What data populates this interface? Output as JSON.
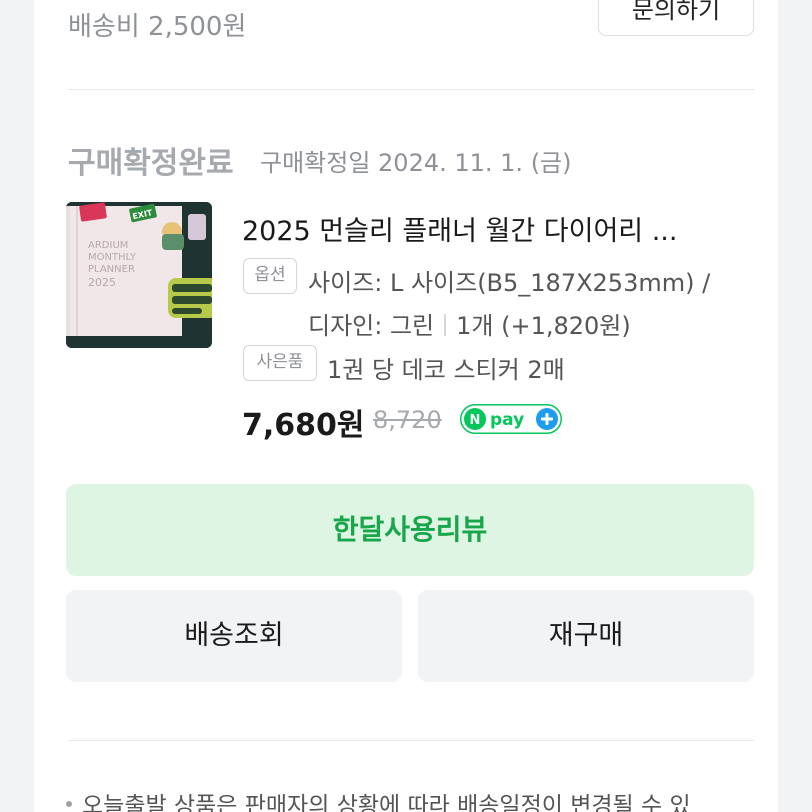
{
  "shipping": {
    "fee_text": "배송비 2,500원",
    "inquiry_label": "문의하기"
  },
  "order": {
    "status": "구매확정완료",
    "confirmed_date": "구매확정일 2024. 11. 1. (금)"
  },
  "product": {
    "title": "2025 먼슬리 플래너 월간 다이어리 ...",
    "option_tag": "옵션",
    "option_line1": "사이즈: L 사이즈(B5_187X253mm) /",
    "option_design": "디자인: 그린",
    "option_qty": "1개 (+1,820원)",
    "gift_tag": "사은품",
    "gift_text": "1권 당 데코 스티커 2매",
    "price": "7,680원",
    "original_price": "8,720",
    "npay_label": "pay",
    "thumbnail": {
      "line1": "ARDIUM",
      "line2": "MONTHLY",
      "line3": "PLANNER",
      "line4": "2025",
      "sticker": "EXIT"
    }
  },
  "actions": {
    "review": "한달사용리뷰",
    "track": "배송조회",
    "rebuy": "재구매"
  },
  "notice": {
    "text": "오늘출발 상품은 판매자의 상황에 따라 배송일정이 변경될 수 있"
  },
  "colors": {
    "accent_green": "#18a64a",
    "review_bg": "#dff5e4",
    "npay_green": "#03c75a",
    "npay_blue": "#1e9cf0"
  }
}
